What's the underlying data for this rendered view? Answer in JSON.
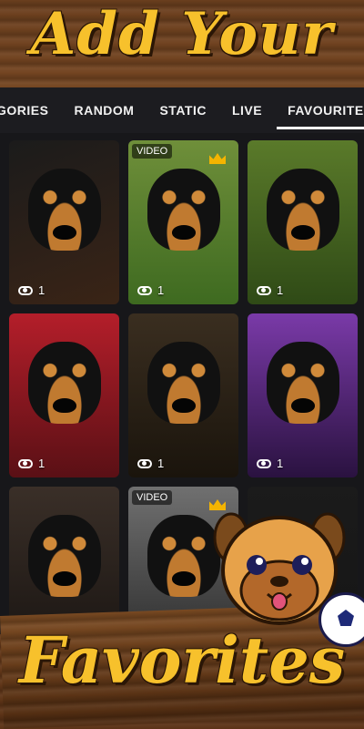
{
  "header": {
    "title": "Add Your"
  },
  "tabs": [
    {
      "label": "GORIES"
    },
    {
      "label": "RANDOM"
    },
    {
      "label": "STATIC"
    },
    {
      "label": "LIVE"
    },
    {
      "label": "FAVOURITE"
    }
  ],
  "tiles": [
    {
      "views": "1",
      "badge": ""
    },
    {
      "views": "1",
      "badge": "VIDEO"
    },
    {
      "views": "1",
      "badge": ""
    },
    {
      "views": "1",
      "badge": ""
    },
    {
      "views": "1",
      "badge": ""
    },
    {
      "views": "1",
      "badge": ""
    },
    {
      "views": "",
      "badge": ""
    },
    {
      "views": "",
      "badge": "VIDEO"
    },
    {
      "views": "",
      "badge": ""
    }
  ],
  "footer": {
    "title": "Favorites"
  },
  "colors": {
    "accent": "#f7c12c",
    "panel": "#17171a",
    "wood": "#7a4a22"
  },
  "icons": {
    "views": "eye-icon",
    "premium": "crown-icon",
    "mascot": "pug-mascot",
    "ball": "soccer-ball-icon"
  }
}
